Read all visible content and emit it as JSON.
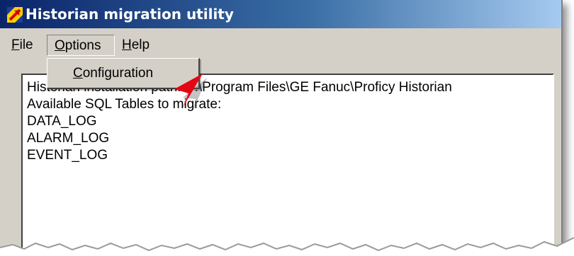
{
  "window": {
    "title": "Historian migration utility"
  },
  "menubar": {
    "file": {
      "prefix": "",
      "accel": "F",
      "rest": "ile"
    },
    "options": {
      "prefix": "",
      "accel": "O",
      "rest": "ptions"
    },
    "help": {
      "prefix": "",
      "accel": "H",
      "rest": "elp"
    }
  },
  "dropdown": {
    "configuration": {
      "prefix": "",
      "accel": "C",
      "rest": "onfiguration"
    }
  },
  "content": {
    "lines": [
      "Historian installation path: C:\\Program Files\\GE Fanuc\\Proficy Historian",
      "Available SQL Tables to migrate:",
      "DATA_LOG",
      "ALARM_LOG",
      "EVENT_LOG"
    ]
  },
  "icons": {
    "app": "historian-app-icon",
    "pointer": "red-pointer-arrow-icon"
  },
  "colors": {
    "titlebar_start": "#0a246a",
    "titlebar_end": "#a6caf0",
    "window_face": "#d4d0c8",
    "pointer": "#e30613"
  }
}
